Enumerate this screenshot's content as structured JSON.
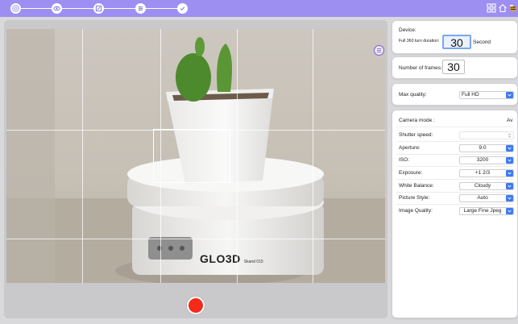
{
  "steps": [
    "turntable-icon",
    "eye-icon",
    "edit-icon",
    "sliders-icon",
    "check-icon"
  ],
  "top_icons": [
    "grid-view-icon",
    "home-icon",
    "bee-logo-icon"
  ],
  "device": {
    "label": "Device:",
    "turn_label": "Full 360 turn duration:",
    "turn_value": "30",
    "turn_unit": "Second"
  },
  "frames": {
    "label": "Number of frames:",
    "value": "30"
  },
  "max_quality": {
    "label": "Max quality:",
    "value": "Full HD"
  },
  "camera": {
    "mode_label": "Camera mode :",
    "mode_value": "Av",
    "rows": [
      {
        "label": "Shutter speed:",
        "value": "",
        "disabled": true
      },
      {
        "label": "Aperture:",
        "value": "9.0"
      },
      {
        "label": "ISO:",
        "value": "3200"
      },
      {
        "label": "Exposure:",
        "value": "+1 2/3"
      },
      {
        "label": "White Balance:",
        "value": "Cloudy"
      },
      {
        "label": "Picture Style:",
        "value": "Auto"
      },
      {
        "label": "Image Quality:",
        "value": "Large Fine Jpeg"
      }
    ]
  },
  "preview": {
    "brand": "GLO3D",
    "model": "Skand 015"
  },
  "colors": {
    "topbar": "#9d8ef2",
    "accent": "#3e7bf1",
    "record": "#f52a1a"
  }
}
